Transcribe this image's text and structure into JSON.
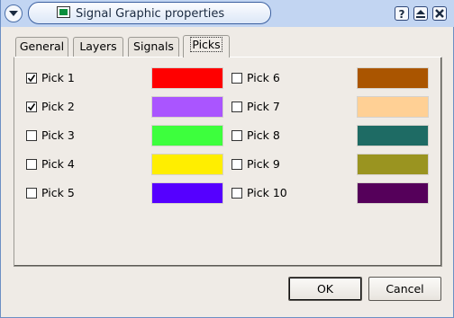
{
  "window": {
    "title": "Signal Graphic properties"
  },
  "tabs": [
    {
      "label": "General"
    },
    {
      "label": "Layers"
    },
    {
      "label": "Signals"
    },
    {
      "label": "Picks",
      "active": true
    }
  ],
  "picks": [
    {
      "label": "Pick 1",
      "checked": true,
      "color": "#ff0000"
    },
    {
      "label": "Pick 2",
      "checked": true,
      "color": "#aa55ff"
    },
    {
      "label": "Pick 3",
      "checked": false,
      "color": "#3dff3d"
    },
    {
      "label": "Pick 4",
      "checked": false,
      "color": "#ffee00"
    },
    {
      "label": "Pick 5",
      "checked": false,
      "color": "#5500ff"
    },
    {
      "label": "Pick 6",
      "checked": false,
      "color": "#aa5500"
    },
    {
      "label": "Pick 7",
      "checked": false,
      "color": "#ffd095"
    },
    {
      "label": "Pick 8",
      "checked": false,
      "color": "#1e6b64"
    },
    {
      "label": "Pick 9",
      "checked": false,
      "color": "#9a9420"
    },
    {
      "label": "Pick 10",
      "checked": false,
      "color": "#55005a"
    }
  ],
  "buttons": {
    "ok": "OK",
    "cancel": "Cancel"
  },
  "icons": {
    "window_menu": "chevron-down-icon",
    "app": "signal-app-icon",
    "help": "question-icon",
    "maximize": "maximize-icon",
    "close": "close-icon"
  }
}
